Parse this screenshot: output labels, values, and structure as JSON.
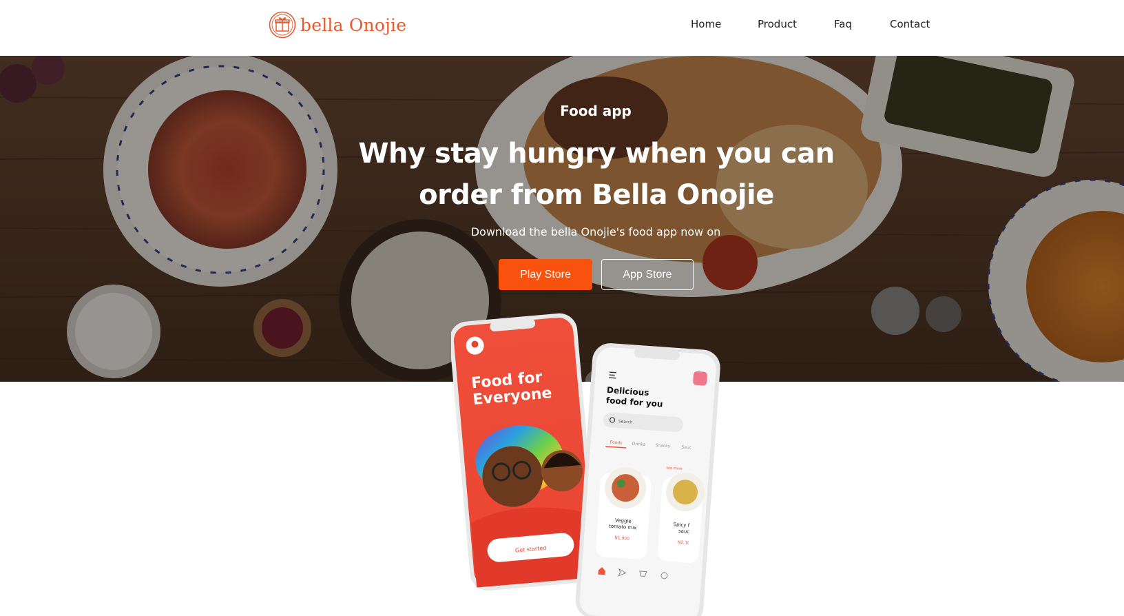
{
  "header": {
    "brand": "bella Onojie",
    "nav": [
      {
        "label": "Home"
      },
      {
        "label": "Product"
      },
      {
        "label": "Faq"
      },
      {
        "label": "Contact"
      }
    ]
  },
  "hero": {
    "eyebrow": "Food app",
    "headline_line1": "Why stay hungry when you can",
    "headline_line2": "order from Bella Onojie",
    "subline": "Download the bella Onojie's food app now on",
    "play_store_label": "Play Store",
    "app_store_label": "App Store"
  },
  "phone_left": {
    "title_line1": "Food for",
    "title_line2": "Everyone",
    "cta": "Get started"
  },
  "phone_right": {
    "heading_line1": "Delicious",
    "heading_line2": "food for you",
    "search_placeholder": "Search",
    "tabs": [
      "Foods",
      "Drinks",
      "Snacks",
      "Sauc"
    ],
    "see_more": "see more",
    "items": [
      {
        "name_line1": "Veggie",
        "name_line2": "tomato mix",
        "price": "N1,900"
      },
      {
        "name_line1": "Spicy f",
        "name_line2": "sauc",
        "price": "N2,3("
      }
    ]
  },
  "colors": {
    "accent": "#f9520e",
    "brand": "#e85a2c",
    "nav_text": "#222222",
    "phone_red": "#ee4a30"
  }
}
